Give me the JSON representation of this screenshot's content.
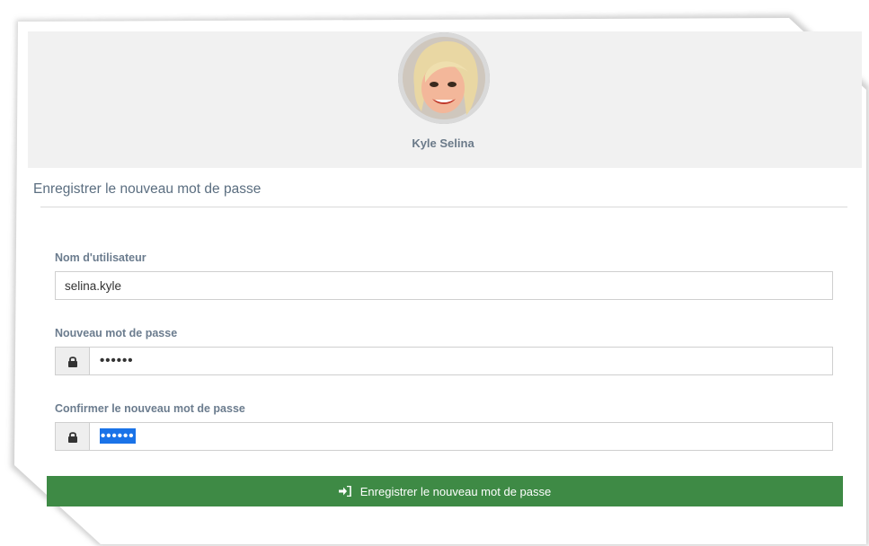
{
  "user": {
    "name": "Kyle Selina"
  },
  "panel": {
    "title": "Enregistrer le nouveau mot de passe"
  },
  "form": {
    "username_label": "Nom d'utilisateur",
    "username_value": "selina.kyle",
    "new_password_label": "Nouveau mot de passe",
    "new_password_value": "••••••",
    "confirm_password_label": "Confirmer le nouveau mot de passe",
    "confirm_password_value": "••••••",
    "submit_label": "Enregistrer le nouveau mot de passe"
  },
  "icons": {
    "password_addon": "lock-icon",
    "submit": "sign-in-icon"
  },
  "colors": {
    "submit_bg": "#3e8a45",
    "header_bg": "#f1f1f1",
    "selection": "#1a73e8"
  }
}
